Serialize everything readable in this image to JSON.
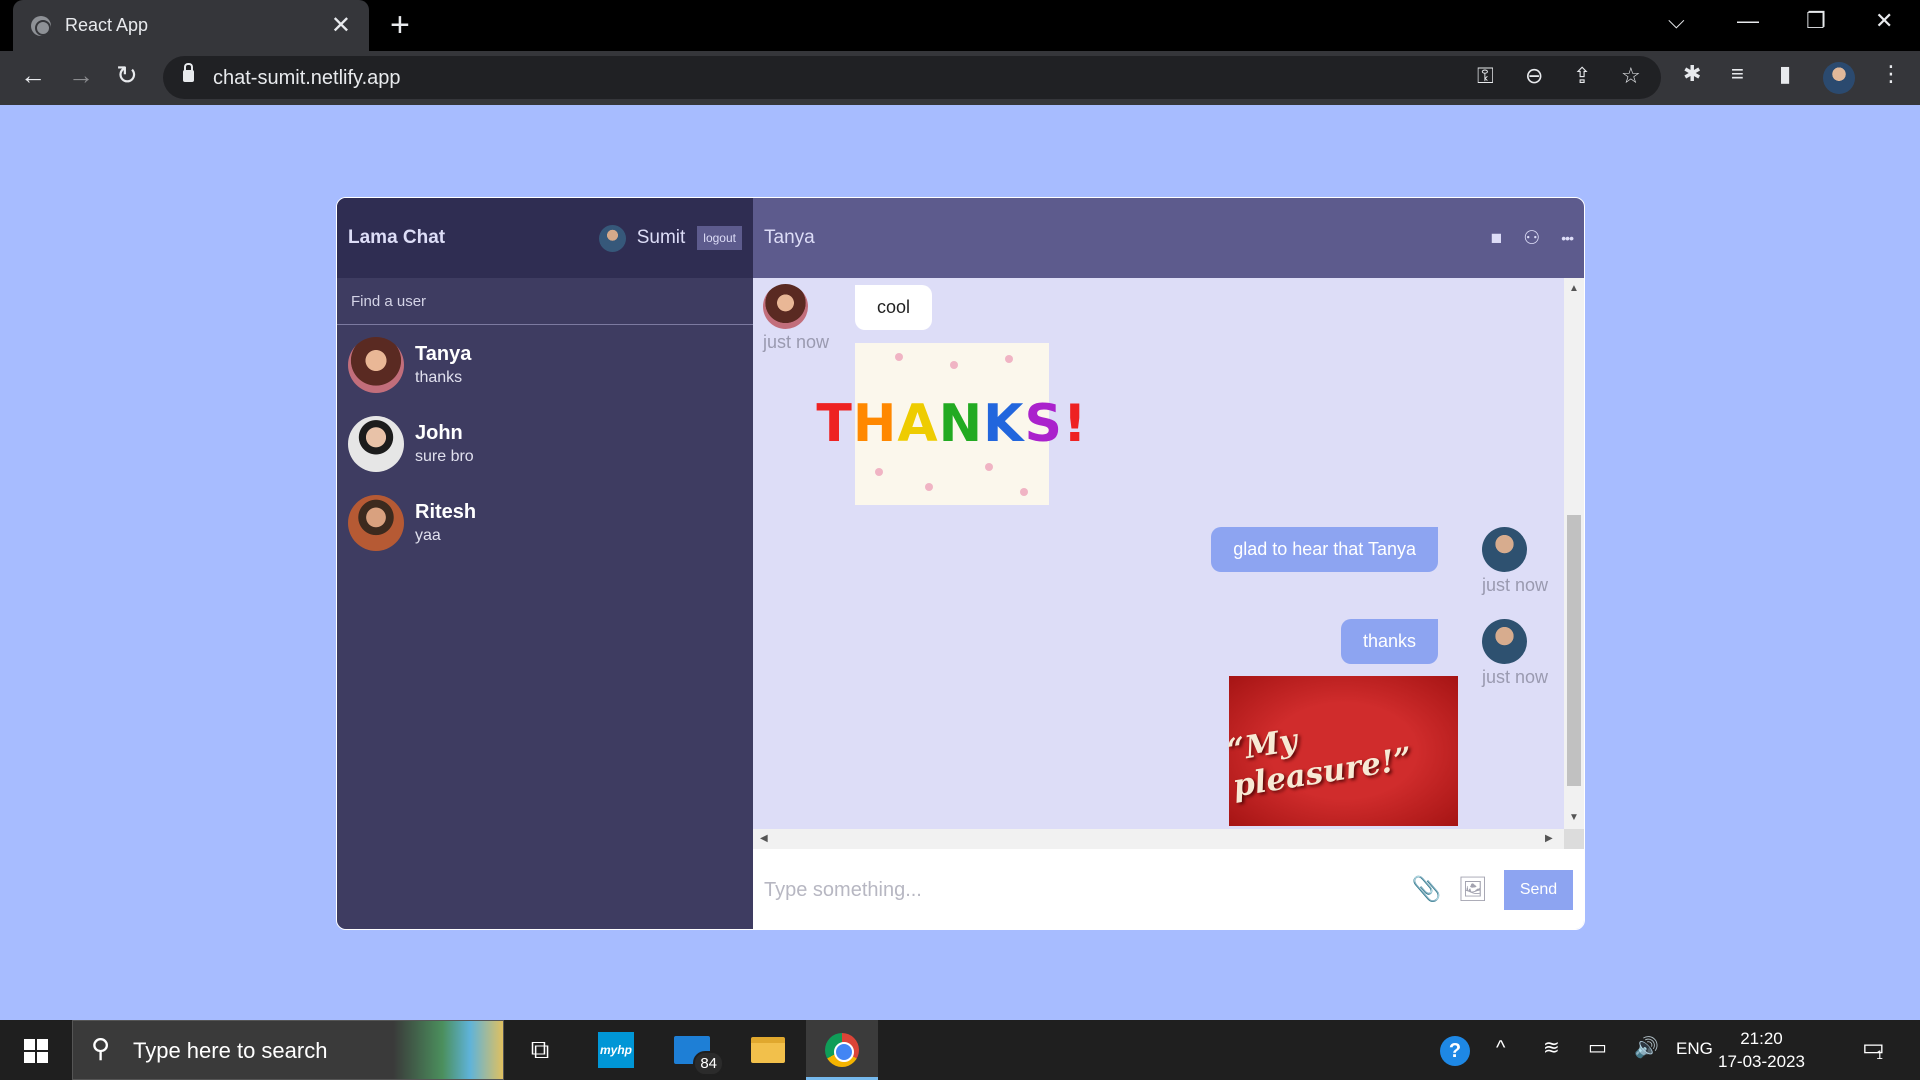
{
  "browser": {
    "tab_title": "React App",
    "tab_close": "✕",
    "new_tab": "+",
    "url": "chat-sumit.netlify.app",
    "window_controls": {
      "tab_search": "⌵",
      "minimize": "—",
      "restore": "❐",
      "close": "✕"
    },
    "nav": {
      "back": "←",
      "forward": "→",
      "reload": "↻"
    },
    "omni_icons": {
      "key": "⚿",
      "zoom": "⊖",
      "share": "⇪",
      "bookmark": "☆"
    },
    "tool_icons": {
      "extensions": "✱",
      "media": "≡",
      "sidepanel": "▮",
      "menu": "⋮"
    }
  },
  "sidebar": {
    "logo": "Lama Chat",
    "user_name": "Sumit",
    "logout_label": "logout",
    "search_placeholder": "Find a user",
    "chats": [
      {
        "name": "Tanya",
        "last": "thanks"
      },
      {
        "name": "John",
        "last": "sure bro"
      },
      {
        "name": "Ritesh",
        "last": "yaa"
      }
    ]
  },
  "chat": {
    "title": "Tanya",
    "header_icons": {
      "video": "■",
      "add_user": "⚇",
      "more": "•••"
    },
    "messages": [
      {
        "from": "Tanya",
        "text": "cool",
        "time": "just now",
        "image": "THANKS!"
      },
      {
        "from": "Sumit",
        "text": "glad to hear that Tanya",
        "time": "just now"
      },
      {
        "from": "Sumit",
        "text": "thanks",
        "time": "just now",
        "image": "\"My pleasure!\""
      }
    ],
    "input_placeholder": "Type something...",
    "attach_icon": "📎",
    "image_icon": "🖼",
    "send_label": "Send"
  },
  "taskbar": {
    "search_placeholder": "Type here to search",
    "search_icon": "⚲",
    "task_view_icon": "⧉",
    "hp_label": "myhp",
    "mail_badge": "84",
    "tray_icons": {
      "help": "?",
      "chevron": "^",
      "wifi": "≋",
      "battery": "▭",
      "volume": "🔊"
    },
    "language": "ENG",
    "time": "21:20",
    "date": "17-03-2023",
    "notification_count": "1"
  },
  "colors": {
    "page_bg": "#a7bcff",
    "sidebar": "#3e3c61",
    "sidebar_header": "#2f2d52",
    "chat_header": "#5d5b8d",
    "chat_bg": "#ddddf7",
    "outgoing": "#8da4f1"
  }
}
